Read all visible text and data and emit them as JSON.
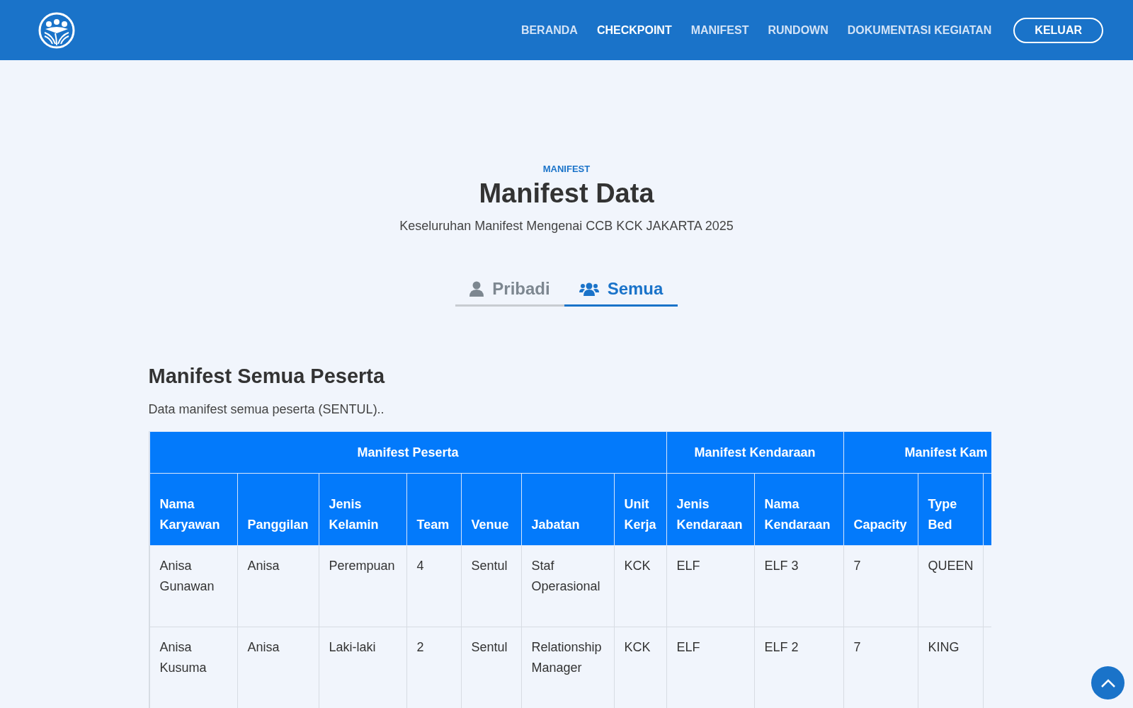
{
  "navbar": {
    "items": [
      {
        "label": "BERANDA",
        "selected": false
      },
      {
        "label": "CHECKPOINT",
        "selected": true
      },
      {
        "label": "MANIFEST",
        "selected": false
      },
      {
        "label": "RUNDOWN",
        "selected": false
      },
      {
        "label": "DOKUMENTASI KEGIATAN",
        "selected": false
      }
    ],
    "logout": "KELUAR"
  },
  "hero": {
    "eyebrow": "MANIFEST",
    "title": "Manifest Data",
    "subtitle": "Keseluruhan Manifest Mengenai CCB KCK JAKARTA 2025"
  },
  "tabs": [
    {
      "label": "Pribadi",
      "kind": "person",
      "selected": false
    },
    {
      "label": "Semua",
      "kind": "group",
      "selected": true
    }
  ],
  "section": {
    "title": "Manifest Semua Peserta",
    "description": "Data manifest semua peserta (SENTUL).."
  },
  "table": {
    "groups": [
      "Manifest Peserta",
      "Manifest Kendaraan",
      "Manifest Kam"
    ],
    "columns": [
      "Nama Karyawan",
      "Panggilan",
      "Jenis Kelamin",
      "Team",
      "Venue",
      "Jabatan",
      "Unit Kerja",
      "Jenis Kendaraan",
      "Nama Kendaraan",
      "Capacity",
      "Type Bed"
    ],
    "rows": [
      [
        "Anisa Gunawan",
        "Anisa",
        "Perempuan",
        "4",
        "Sentul",
        "Staf Operasional",
        "KCK",
        "ELF",
        "ELF 3",
        "7",
        "QUEEN"
      ],
      [
        "Anisa Kusuma",
        "Anisa",
        "Laki-laki",
        "2",
        "Sentul",
        "Relationship Manager",
        "KCK",
        "ELF",
        "ELF 2",
        "7",
        "KING"
      ]
    ]
  }
}
